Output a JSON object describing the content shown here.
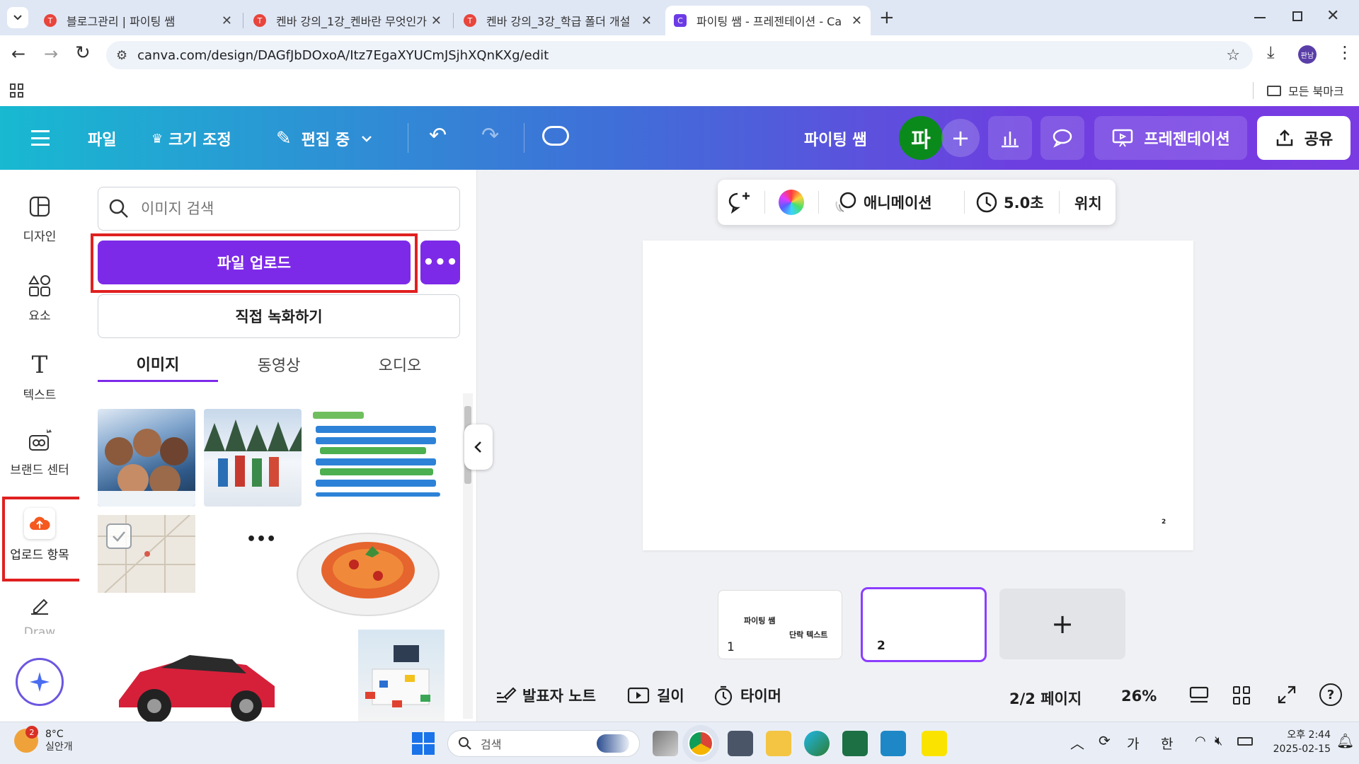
{
  "browser": {
    "tabs": [
      {
        "title": "블로그관리 | 파이팅 쌤",
        "active": false
      },
      {
        "title": "켄바 강의_1강_켄바란 무엇인가",
        "active": false
      },
      {
        "title": "켄바 강의_3강_학급 폴더 개설",
        "active": false
      },
      {
        "title": "파이팅 쌤 - 프레젠테이션 - Canva",
        "active": true
      }
    ],
    "url": "canva.com/design/DAGfJbDOxoA/Itz7EgaXYUCmJSjhXQnKXg/edit",
    "profile_label": "판남",
    "bookmarks_label": "모든 북마크"
  },
  "header": {
    "menu_file": "파일",
    "resize": "크기 조정",
    "editing": "편집 중",
    "project_name": "파이팅 쌤",
    "avatar_letter": "파",
    "present": "프레젠테이션",
    "share": "공유"
  },
  "rail": {
    "items": [
      {
        "label": "디자인",
        "icon": "design-icon"
      },
      {
        "label": "요소",
        "icon": "elements-icon"
      },
      {
        "label": "텍스트",
        "icon": "text-icon"
      },
      {
        "label": "브랜드 센터",
        "icon": "brand-icon"
      },
      {
        "label": "업로드 항목",
        "icon": "upload-cloud-icon"
      },
      {
        "label": "Draw",
        "icon": "draw-icon"
      }
    ]
  },
  "panel": {
    "search_placeholder": "이미지 검색",
    "upload_button": "파일 업로드",
    "record_button": "직접 녹화하기",
    "tabs": [
      "이미지",
      "동영상",
      "오디오"
    ],
    "active_tab": "이미지"
  },
  "context_toolbar": {
    "animation": "애니메이션",
    "duration": "5.0초",
    "position": "위치"
  },
  "canvas": {
    "page_number_mark": "2"
  },
  "thumbnails": [
    {
      "number": "1",
      "title": "파이팅 쌤",
      "subtitle": "단락 텍스트"
    },
    {
      "number": "2",
      "title": "",
      "subtitle": ""
    }
  ],
  "footer": {
    "notes": "발표자 노트",
    "duration": "길이",
    "timer": "타이머",
    "pages": "2/2 페이지",
    "zoom": "26%"
  },
  "taskbar": {
    "weather_temp": "8°C",
    "weather_desc": "실안개",
    "weather_badge": "2",
    "search": "검색",
    "ime1": "가",
    "ime2": "한",
    "time": "오후 2:44",
    "date": "2025-02-15"
  },
  "colors": {
    "canva_purple": "#7d2ae8",
    "highlight_red": "#e02020",
    "avatar_green": "#0b8a1c"
  }
}
